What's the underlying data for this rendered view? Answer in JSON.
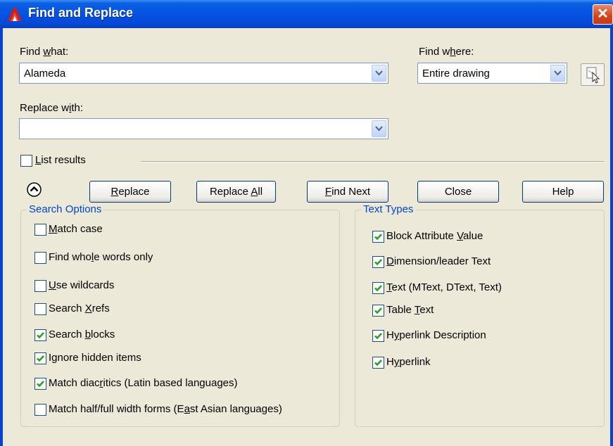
{
  "window": {
    "title": "Find and Replace",
    "close_glyph": "✕"
  },
  "find_what": {
    "label_pre": "Find ",
    "label_key": "w",
    "label_post": "hat:",
    "value": "Alameda"
  },
  "find_where": {
    "label_pre": "Find w",
    "label_key": "h",
    "label_post": "ere:",
    "value": "Entire drawing"
  },
  "replace_with": {
    "label_pre": "Replace w",
    "label_key": "i",
    "label_post": "th:",
    "value": ""
  },
  "list_results": {
    "label_pre": "",
    "label_key": "L",
    "label_post": "ist results",
    "checked": false
  },
  "buttons": {
    "replace": {
      "pre": "",
      "key": "R",
      "post": "eplace"
    },
    "replace_all": {
      "pre": "Replace ",
      "key": "A",
      "post": "ll"
    },
    "find_next": {
      "pre": "",
      "key": "F",
      "post": "ind Next"
    },
    "close": {
      "label": "Close"
    },
    "help": {
      "label": "Help"
    }
  },
  "search_options": {
    "title": "Search Options",
    "items": [
      {
        "pre": "",
        "key": "M",
        "post": "atch case",
        "checked": false
      },
      {
        "pre": "Find who",
        "key": "l",
        "post": "e words only",
        "checked": false
      },
      {
        "pre": "",
        "key": "U",
        "post": "se wildcards",
        "checked": false
      },
      {
        "pre": "Search ",
        "key": "X",
        "post": "refs",
        "checked": false
      },
      {
        "pre": "Search ",
        "key": "b",
        "post": "locks",
        "checked": true
      },
      {
        "pre": "I",
        "key": "g",
        "post": "nore hidden items",
        "checked": true
      },
      {
        "pre": "Match diac",
        "key": "r",
        "post": "itics (Latin based languages)",
        "checked": true
      },
      {
        "pre": "Match half/full width forms (E",
        "key": "a",
        "post": "st Asian languages)",
        "checked": false
      }
    ]
  },
  "text_types": {
    "title": "Text Types",
    "items": [
      {
        "pre": "Block Attribute ",
        "key": "V",
        "post": "alue",
        "checked": true
      },
      {
        "pre": "",
        "key": "D",
        "post": "imension/leader Text",
        "checked": true
      },
      {
        "pre": "",
        "key": "T",
        "post": "ext (MText, DText, Text)",
        "checked": true
      },
      {
        "pre": "Table ",
        "key": "T",
        "post": "ext",
        "checked": true
      },
      {
        "pre": "H",
        "key": "y",
        "post": "perlink Description",
        "checked": true
      },
      {
        "pre": "H",
        "key": "y",
        "post": "perlink",
        "checked": true
      }
    ]
  },
  "colors": {
    "titlebar": "#0553e3",
    "group_title": "#0046d5",
    "dialog_bg": "#ece9d8",
    "check": "#21a121"
  }
}
